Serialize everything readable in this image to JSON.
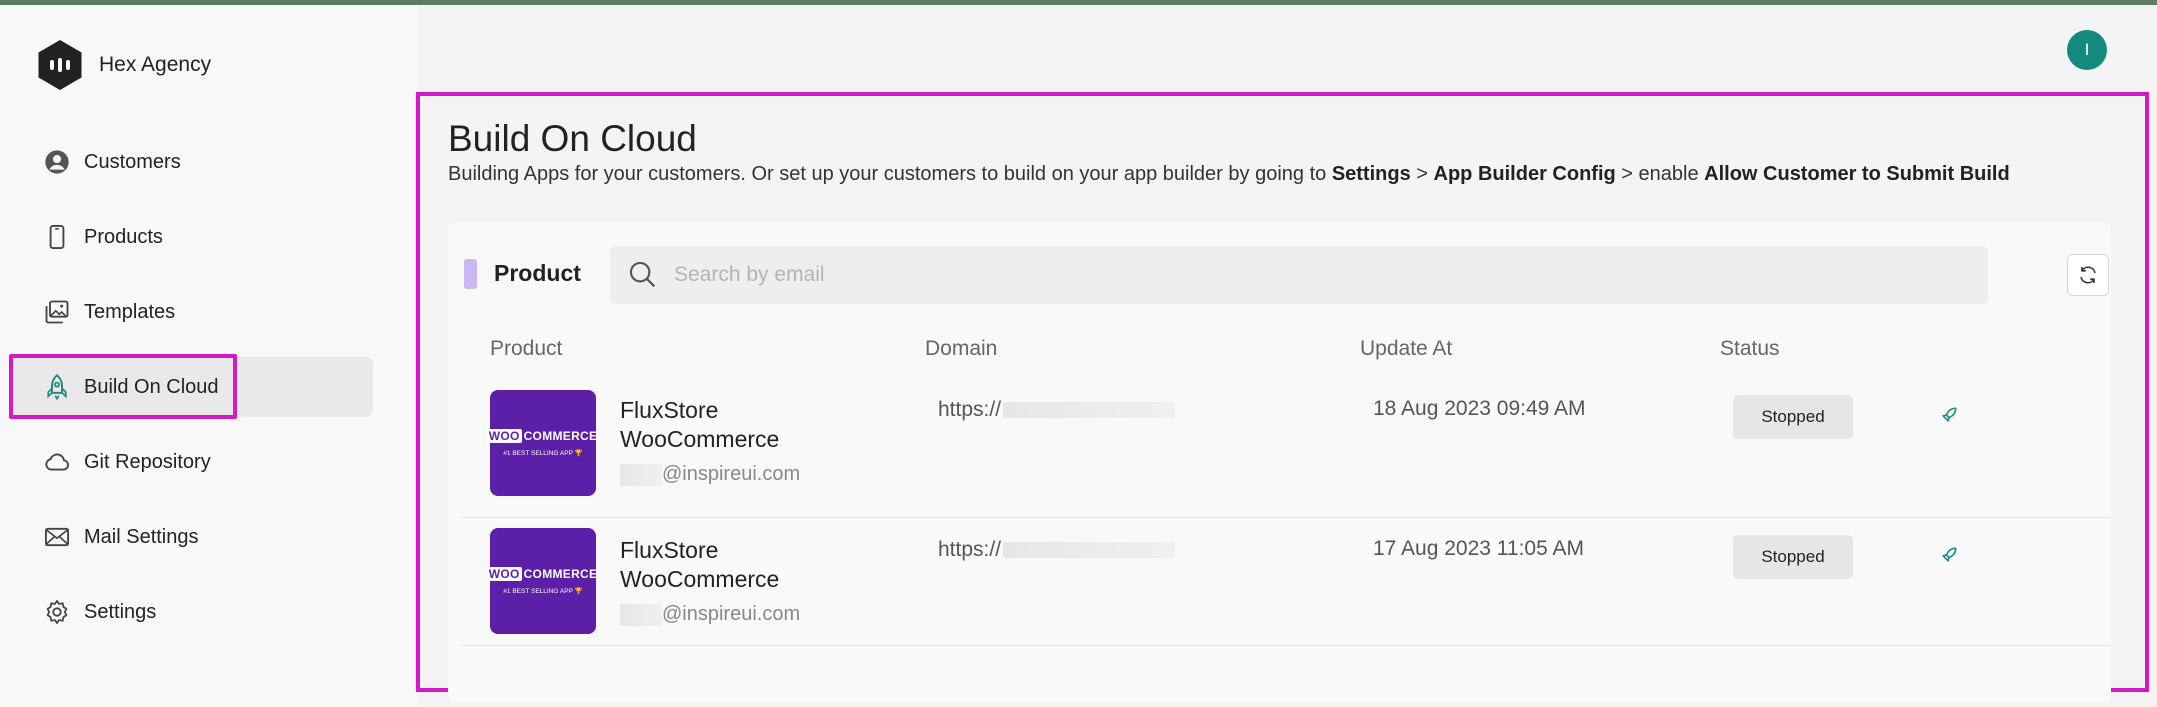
{
  "brand": {
    "name": "Hex Agency"
  },
  "sidebar": {
    "items": [
      {
        "label": "Customers",
        "icon": "user-circle-icon"
      },
      {
        "label": "Products",
        "icon": "phone-icon"
      },
      {
        "label": "Templates",
        "icon": "images-icon"
      },
      {
        "label": "Build On Cloud",
        "icon": "rocket-icon",
        "active": true
      },
      {
        "label": "Git Repository",
        "icon": "cloud-icon"
      },
      {
        "label": "Mail Settings",
        "icon": "mail-icon"
      },
      {
        "label": "Settings",
        "icon": "gear-icon"
      }
    ]
  },
  "header": {
    "avatar_initial": "I"
  },
  "page": {
    "title": "Build On Cloud",
    "subtitle_parts": {
      "p1": "Building Apps for your customers. Or set up your customers to build on your app builder by going to ",
      "b1": "Settings",
      "p2": " > ",
      "b2": "App Builder Config",
      "p3": " > enable ",
      "b3": "Allow Customer to Submit Build"
    }
  },
  "card": {
    "label": "Product",
    "search_placeholder": "Search by email"
  },
  "table": {
    "columns": [
      "Product",
      "Domain",
      "Update At",
      "Status"
    ],
    "rows": [
      {
        "name": "FluxStore WooCommerce",
        "email": "@inspireui.com",
        "domain": "https://",
        "updated": "18 Aug 2023 09:49 AM",
        "status": "Stopped",
        "thumb_brand": "COMMERCE",
        "thumb_brand_prefix": "WOO",
        "thumb_tag": "#1 BEST SELLING APP 🏆"
      },
      {
        "name": "FluxStore WooCommerce",
        "email": "@inspireui.com",
        "domain": "https://",
        "updated": "17 Aug 2023 11:05 AM",
        "status": "Stopped",
        "thumb_brand": "COMMERCE",
        "thumb_brand_prefix": "WOO",
        "thumb_tag": "#1 BEST SELLING APP 🏆"
      }
    ]
  },
  "colors": {
    "accent_highlight": "#d41bc2",
    "avatar": "#128a7d",
    "thumb_bg": "#5b1fa8",
    "label_bar": "#c9b8f4"
  }
}
